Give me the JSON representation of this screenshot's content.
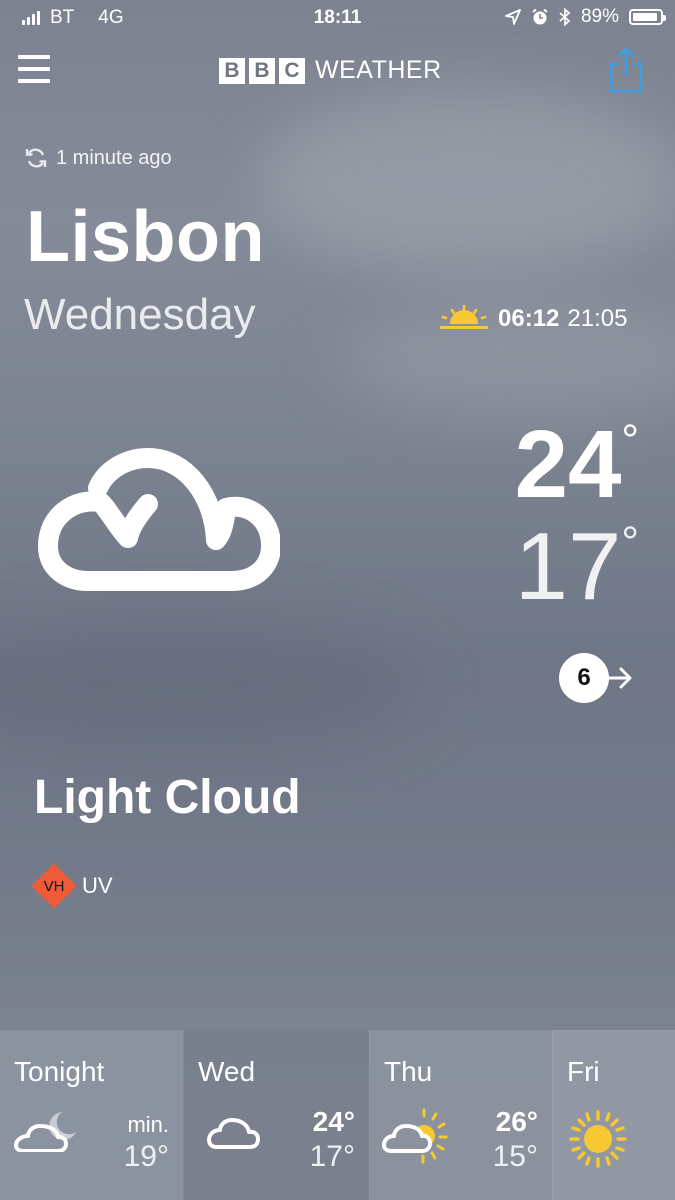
{
  "status_bar": {
    "carrier": "BT",
    "network": "4G",
    "time": "18:11",
    "battery": "89%"
  },
  "header": {
    "logo_letters": [
      "B",
      "B",
      "C"
    ],
    "logo_word": "WEATHER"
  },
  "updated": "1 minute ago",
  "location": "Lisbon",
  "day": "Wednesday",
  "sunrise": "06:12",
  "sunset": "21:05",
  "current": {
    "icon": "light-cloud-icon",
    "max_temp": "24",
    "min_temp": "17",
    "degree": "°",
    "wind_speed": "6",
    "condition": "Light Cloud",
    "uv_level": "VH",
    "uv_label": "UV"
  },
  "forecast": [
    {
      "label": "Tonight",
      "icon": "partly-cloudy-night-icon",
      "min_label": "min.",
      "low": "19°"
    },
    {
      "label": "Wed",
      "icon": "light-cloud-icon",
      "high": "24°",
      "low": "17°"
    },
    {
      "label": "Thu",
      "icon": "sunny-intervals-icon",
      "high": "26°",
      "low": "15°"
    },
    {
      "label": "Fri",
      "icon": "sunny-icon"
    }
  ],
  "colors": {
    "uv_very_high": "#ef5a39",
    "sun_yellow": "#f6c933",
    "share_blue": "#3aa0e6"
  }
}
